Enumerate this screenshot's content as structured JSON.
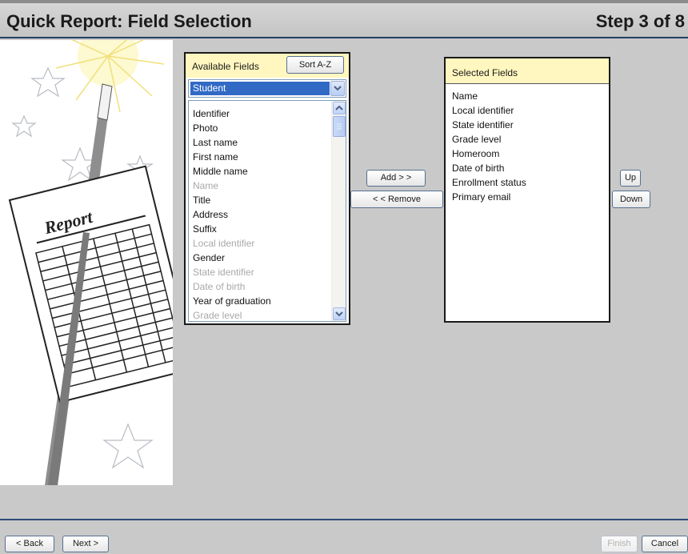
{
  "header": {
    "title": "Quick Report: Field Selection",
    "step": "Step 3 of 8"
  },
  "illustration": {
    "report_label": "Report"
  },
  "available": {
    "label": "Available Fields",
    "sort_button": "Sort A-Z",
    "category_selected": "Student",
    "items": [
      {
        "label": "Identifier",
        "enabled": true
      },
      {
        "label": "Photo",
        "enabled": true
      },
      {
        "label": "Last name",
        "enabled": true
      },
      {
        "label": "First name",
        "enabled": true
      },
      {
        "label": "Middle name",
        "enabled": true
      },
      {
        "label": "Name",
        "enabled": false
      },
      {
        "label": "Title",
        "enabled": true
      },
      {
        "label": "Address",
        "enabled": true
      },
      {
        "label": "Suffix",
        "enabled": true
      },
      {
        "label": "Local identifier",
        "enabled": false
      },
      {
        "label": "Gender",
        "enabled": true
      },
      {
        "label": "State identifier",
        "enabled": false
      },
      {
        "label": "Date of birth",
        "enabled": false
      },
      {
        "label": "Year of graduation",
        "enabled": true
      },
      {
        "label": "Grade level",
        "enabled": false
      }
    ]
  },
  "transfer": {
    "add_button": "Add > >",
    "remove_button": "< < Remove"
  },
  "selected": {
    "label": "Selected Fields",
    "items": [
      "Name",
      "Local identifier",
      "State identifier",
      "Grade level",
      "Homeroom",
      "Date of birth",
      "Enrollment status",
      "Primary email"
    ],
    "up_button": "Up",
    "down_button": "Down"
  },
  "footer": {
    "back_button": "< Back",
    "next_button": "Next >",
    "finish_button": "Finish",
    "cancel_button": "Cancel"
  }
}
